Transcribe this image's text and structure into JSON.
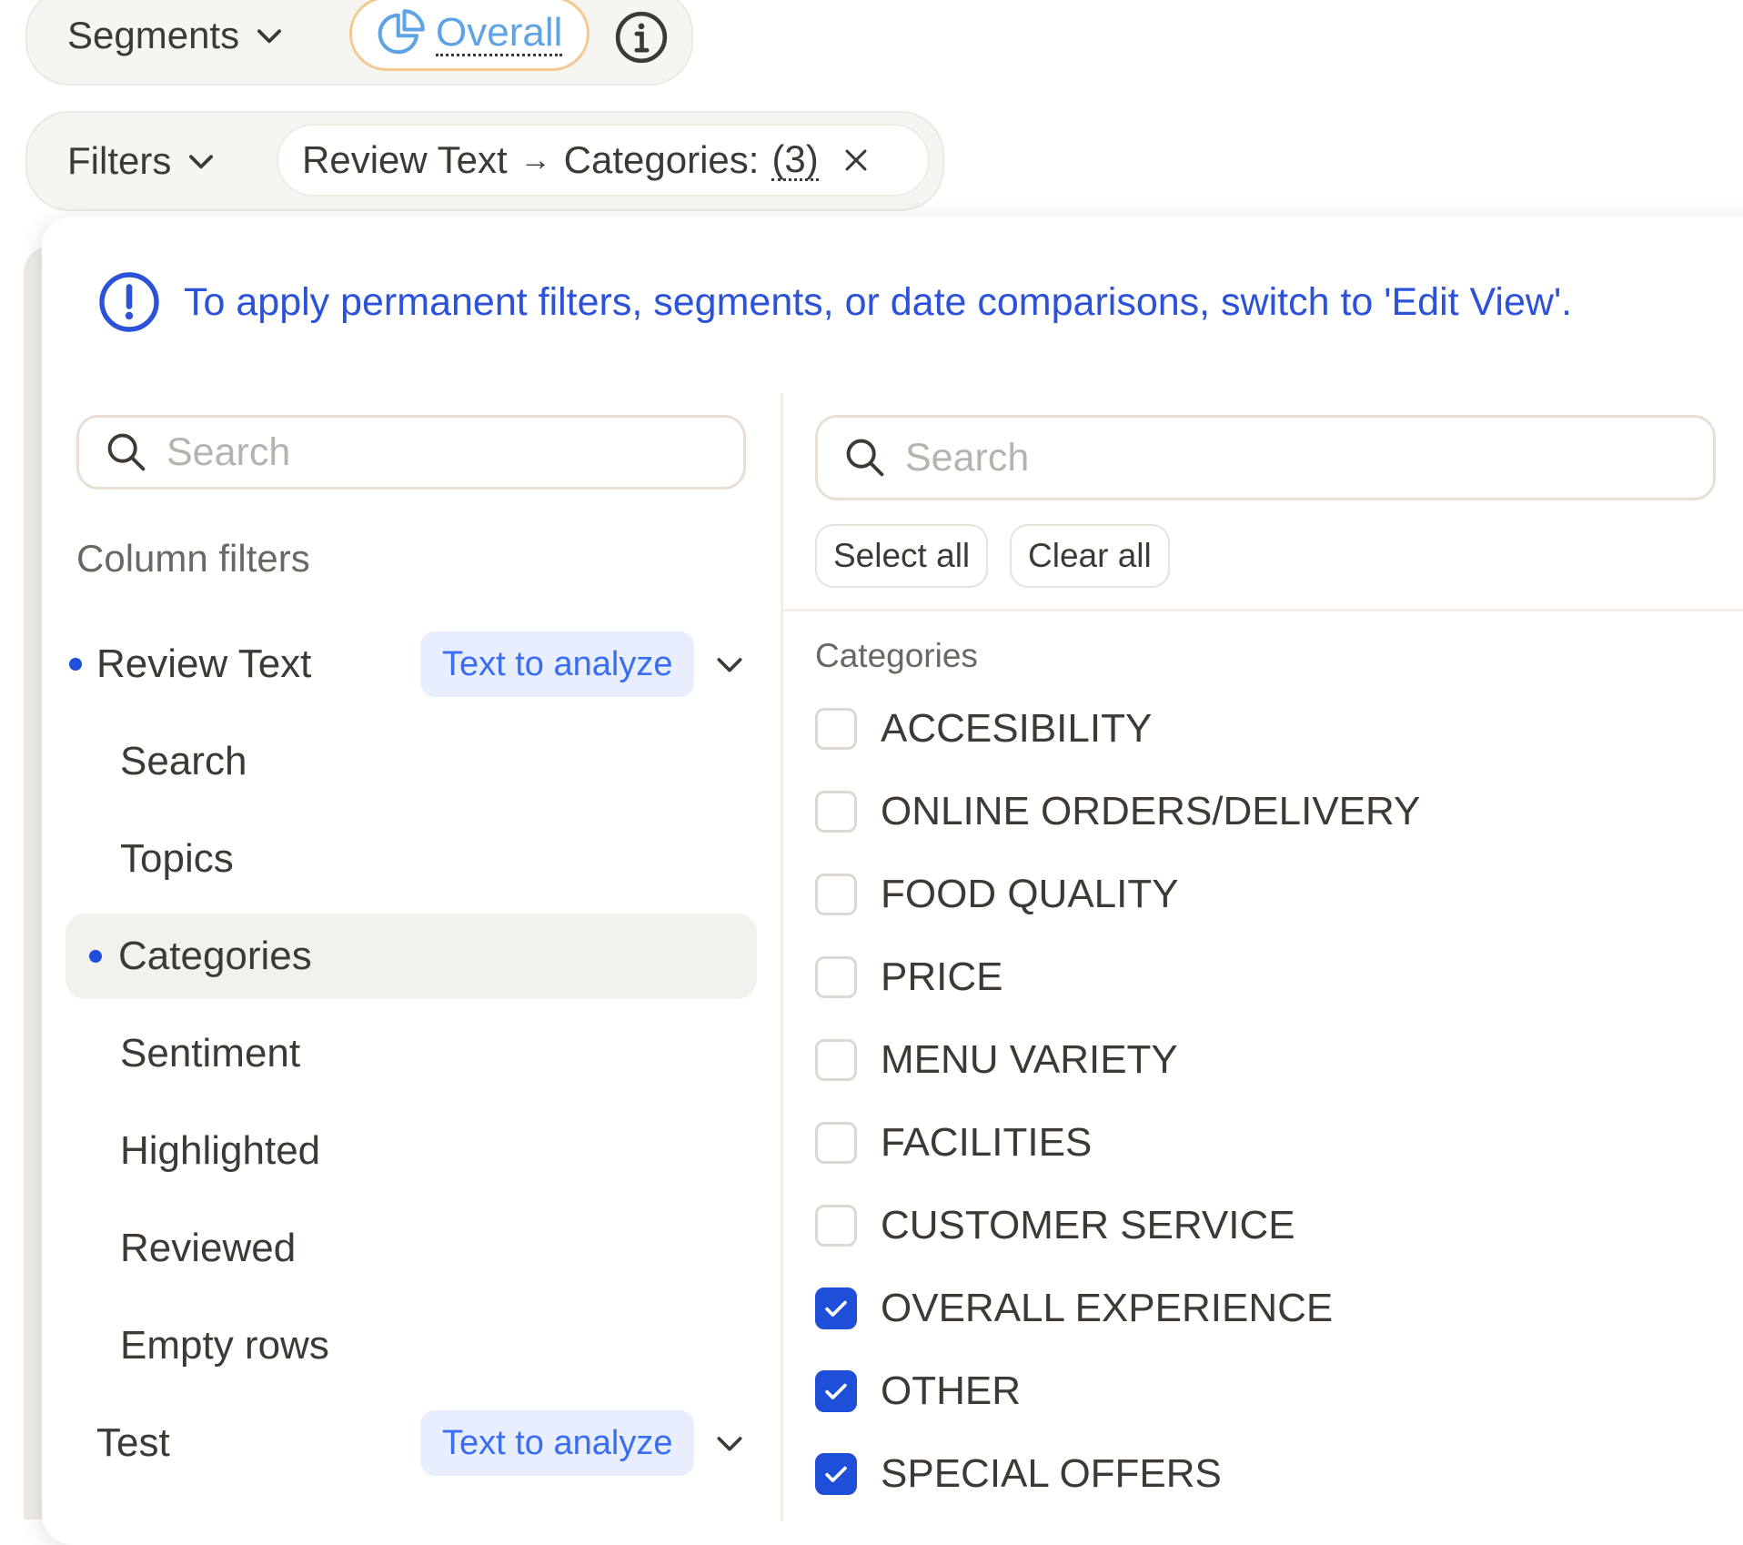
{
  "toolbar": {
    "segments_label": "Segments",
    "segment_pill_label": "Overall",
    "filters_label": "Filters",
    "filter_chip": {
      "column": "Review Text",
      "arrow": "→",
      "field": "Categories:",
      "count": "(3)"
    }
  },
  "panel": {
    "notice": "To apply permanent filters, segments, or date comparisons, switch to 'Edit View'.",
    "left": {
      "search_placeholder": "Search",
      "section_title": "Column filters",
      "columns": [
        {
          "label": "Review Text",
          "tag": "Text to analyze",
          "has_active": true,
          "sub_items": [
            {
              "label": "Search",
              "active": false
            },
            {
              "label": "Topics",
              "active": false
            },
            {
              "label": "Categories",
              "active": true
            },
            {
              "label": "Sentiment",
              "active": false
            },
            {
              "label": "Highlighted",
              "active": false
            },
            {
              "label": "Reviewed",
              "active": false
            },
            {
              "label": "Empty rows",
              "active": false
            }
          ]
        },
        {
          "label": "Test",
          "tag": "Text to analyze",
          "has_active": false
        }
      ]
    },
    "right": {
      "search_placeholder": "Search",
      "select_all_label": "Select all",
      "clear_all_label": "Clear all",
      "heading": "Categories",
      "options": [
        {
          "label": "ACCESIBILITY",
          "checked": false
        },
        {
          "label": "ONLINE ORDERS/DELIVERY",
          "checked": false
        },
        {
          "label": "FOOD QUALITY",
          "checked": false
        },
        {
          "label": "PRICE",
          "checked": false
        },
        {
          "label": "MENU VARIETY",
          "checked": false
        },
        {
          "label": "FACILITIES",
          "checked": false
        },
        {
          "label": "CUSTOMER SERVICE",
          "checked": false
        },
        {
          "label": "OVERALL EXPERIENCE",
          "checked": true
        },
        {
          "label": "OTHER",
          "checked": true
        },
        {
          "label": "SPECIAL OFFERS",
          "checked": true
        }
      ]
    }
  },
  "colors": {
    "accent_blue": "#1f4fd8",
    "notice_blue": "#2b52d8",
    "tag_bg": "#e8eefe",
    "pill_border": "#f3c891"
  },
  "icons": {
    "segments": "chevron-down-icon",
    "overall": "pie-chart-icon",
    "info": "info-icon",
    "filters": "chevron-down-icon",
    "chip_remove": "close-icon",
    "notice": "alert-circle-icon",
    "search": "search-icon",
    "checkbox": "check-icon"
  }
}
